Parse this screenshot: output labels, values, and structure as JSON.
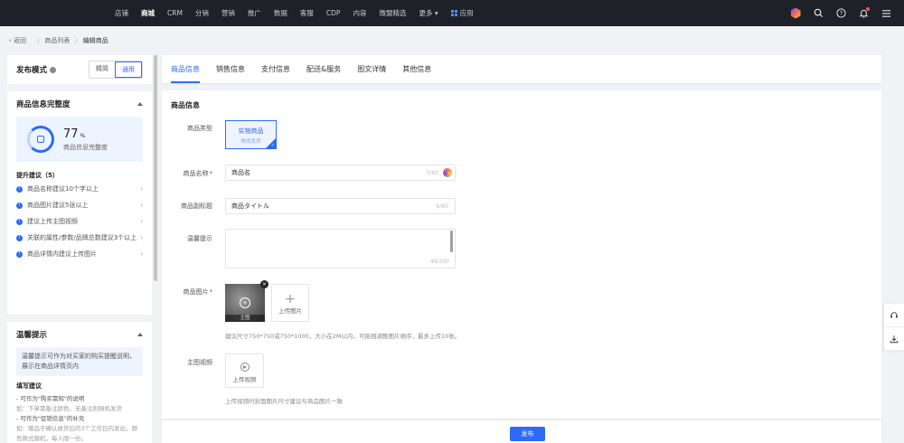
{
  "nav": {
    "items": [
      "店铺",
      "商城",
      "CRM",
      "分销",
      "营销",
      "推广",
      "数据",
      "客服",
      "CDP",
      "内容",
      "微盟精选",
      "更多"
    ],
    "active_index": 1,
    "apps_label": "应用",
    "icons": [
      "brand-hex-icon",
      "search-icon",
      "help-icon",
      "bell-icon",
      "menu-icon"
    ]
  },
  "breadcrumb": {
    "back": "返回",
    "list": "商品列表",
    "current": "编辑商品"
  },
  "left": {
    "mode": {
      "label": "发布模式",
      "options": [
        "精简",
        "通用"
      ],
      "selected": "通用"
    },
    "completeness": {
      "title": "商品信息完整度",
      "percent": "77",
      "unit": "%",
      "caption": "商品信息完整度",
      "tips_title": "提升建议（5）",
      "tips": [
        "商品名称建议10个字以上",
        "商品图片建议5张以上",
        "建议上传主图视频",
        "关联的属性/参数/品牌总数建议3个以上",
        "商品详情内建议上传图片"
      ]
    },
    "warm": {
      "title": "温馨提示",
      "box": "温馨提示可作为对买家的购买提醒说明，展示在商品详情页内",
      "fill_title": "填写建议",
      "lines": [
        "- 可作为\"购买需知\"的说明",
        "如：下单需备注颜色，无备注则随机发货",
        "- 可作为\"促销信息\"的补充",
        "如：赠品于确认收货后的3个工作日内发出，颜色款式随机，每人限一份。"
      ]
    }
  },
  "tabs": [
    "商品信息",
    "销售信息",
    "支付信息",
    "配送&服务",
    "图文详情",
    "其他信息"
  ],
  "active_tab": 0,
  "form": {
    "section_title": "商品信息",
    "type_label": "商品类型",
    "type_card": {
      "title": "实物商品",
      "sub": "物流发货"
    },
    "name_label": "商品名称",
    "name_value": "商品名",
    "name_count": "3/60",
    "subtitle_label": "商品副标题",
    "subtitle_value": "商品タイトル",
    "subtitle_count": "6/60",
    "warm_label": "温馨提示",
    "warm_count": "49/300",
    "image_label": "商品图片",
    "image_main_tag": "主图",
    "upload_image": "上传图片",
    "image_hint": "建议尺寸750*750或750*1000，大小在2M以内，可拖拽调整图片顺序，最多上传10张。",
    "video_label": "主图视频",
    "upload_video": "上传视频",
    "video_hint": "上传视频时封面图片尺寸建议与商品图片一致"
  },
  "footer": {
    "publish": "发布"
  },
  "colors": {
    "primary": "#2d6bf6",
    "nav_bg": "#1e2128"
  }
}
